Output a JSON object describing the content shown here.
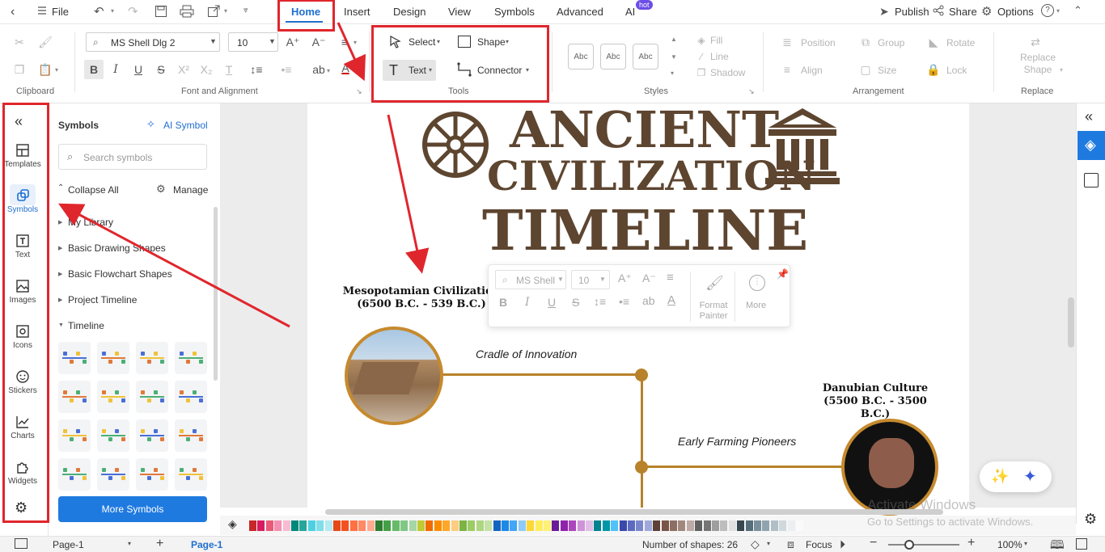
{
  "menubar": {
    "file": "File",
    "tabs": [
      "Home",
      "Insert",
      "Design",
      "View",
      "Symbols",
      "Advanced",
      "AI"
    ],
    "ai_badge": "hot",
    "publish": "Publish",
    "share": "Share",
    "options": "Options"
  },
  "ribbon": {
    "clipboard_label": "Clipboard",
    "font_name": "MS Shell Dlg 2",
    "font_size": "10",
    "font_group_label": "Font and Alignment",
    "select": "Select",
    "shape": "Shape",
    "text": "Text",
    "connector": "Connector",
    "tools_label": "Tools",
    "style_samples": [
      "Abc",
      "Abc",
      "Abc"
    ],
    "styles_label": "Styles",
    "fill": "Fill",
    "line": "Line",
    "shadow": "Shadow",
    "position": "Position",
    "group": "Group",
    "rotate": "Rotate",
    "align": "Align",
    "size": "Size",
    "lock": "Lock",
    "arrangement_label": "Arrangement",
    "replace_shape": "Replace Shape",
    "replace_label": "Replace"
  },
  "iconbar": {
    "items": [
      "Templates",
      "Symbols",
      "Text",
      "Images",
      "Icons",
      "Stickers",
      "Charts",
      "Widgets"
    ]
  },
  "symbols_panel": {
    "title": "Symbols",
    "ai_symbol": "AI Symbol",
    "search_placeholder": "Search symbols",
    "collapse_all": "Collapse All",
    "manage": "Manage",
    "tree": [
      "My Library",
      "Basic Drawing Shapes",
      "Basic Flowchart Shapes",
      "Project Timeline",
      "Timeline"
    ],
    "more_symbols": "More Symbols"
  },
  "canvas": {
    "title_line1": "ANCIENT",
    "title_line2": "CIVILIZATION",
    "title_line3": "TIMELINE",
    "node1_title": "Mesopotamian Civilization",
    "node1_dates": "(6500 B.C. - 539 B.C.)",
    "node1_caption": "Cradle of Innovation",
    "node2_title": "Danubian Culture",
    "node2_dates": "(5500 B.C. - 3500 B.C.)",
    "node2_caption": "Early Farming Pioneers",
    "timeline_color": "#b8822a"
  },
  "float_toolbar": {
    "font": "MS Shell",
    "size": "10",
    "format_painter": "Format Painter",
    "more": "More"
  },
  "watermark": {
    "line1": "Activate Windows",
    "line2": "Go to Settings to activate Windows."
  },
  "statusbar": {
    "page_tab1": "Page-1",
    "page_tab2": "Page-1",
    "shapes": "Number of shapes: 26",
    "focus": "Focus",
    "zoom": "100%"
  },
  "palette": [
    "#c62828",
    "#d81b60",
    "#e85a77",
    "#f48fb1",
    "#f8bbd0",
    "#00897b",
    "#26a69a",
    "#4dd0e1",
    "#80deea",
    "#b2ebf2",
    "#e64a19",
    "#f4511e",
    "#ff7043",
    "#ff8a65",
    "#ffab91",
    "#2e7d32",
    "#43a047",
    "#66bb6a",
    "#81c784",
    "#a5d6a7",
    "#c0ca33",
    "#ef6c00",
    "#fb8c00",
    "#ffa726",
    "#ffcc80",
    "#7cb342",
    "#9ccc65",
    "#aed581",
    "#c5e1a5",
    "#1565c0",
    "#1e88e5",
    "#42a5f5",
    "#90caf9",
    "#fdd835",
    "#ffee58",
    "#fff176",
    "#6a1b9a",
    "#8e24aa",
    "#ab47bc",
    "#ce93d8",
    "#e1bee7",
    "#00838f",
    "#0097a7",
    "#4fc3f7",
    "#3949ab",
    "#5c6bc0",
    "#7986cb",
    "#9fa8da",
    "#5d4037",
    "#795548",
    "#8d6e63",
    "#a1887f",
    "#bcaaa4",
    "#616161",
    "#757575",
    "#9e9e9e",
    "#bdbdbd",
    "#e0e0e0",
    "#37474f",
    "#546e7a",
    "#78909c",
    "#90a4ae",
    "#b0bec5",
    "#cfd8dc",
    "#eceff1",
    "#fafafa"
  ]
}
